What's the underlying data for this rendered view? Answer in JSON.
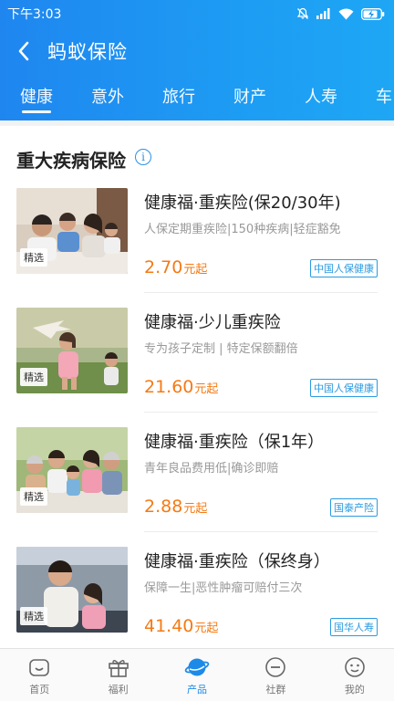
{
  "status_bar": {
    "time": "下午3:03"
  },
  "header": {
    "title": "蚂蚁保险"
  },
  "tabs": [
    "健康",
    "意外",
    "旅行",
    "财产",
    "人寿",
    "车"
  ],
  "section": {
    "title": "重大疾病保险",
    "info_icon": "i"
  },
  "products": [
    {
      "name": "健康福·重疾险(保20/30年)",
      "desc": "人保定期重疾险|150种疾病|轻症豁免",
      "price": "2.70",
      "unit": "元起",
      "tag": "精选",
      "insurer": "中国人保健康"
    },
    {
      "name": "健康福·少儿重疾险",
      "desc": "专为孩子定制 | 特定保额翻倍",
      "price": "21.60",
      "unit": "元起",
      "tag": "精选",
      "insurer": "中国人保健康"
    },
    {
      "name": "健康福·重疾险（保1年）",
      "desc": "青年良品费用低|确诊即赔",
      "price": "2.88",
      "unit": "元起",
      "tag": "精选",
      "insurer": "国泰产险"
    },
    {
      "name": "健康福·重疾险（保终身）",
      "desc": "保障一生|恶性肿瘤可赔付三次",
      "price": "41.40",
      "unit": "元起",
      "tag": "精选",
      "insurer": "国华人寿"
    }
  ],
  "bottom_nav": [
    {
      "label": "首页",
      "icon": "home-icon"
    },
    {
      "label": "福利",
      "icon": "gift-icon"
    },
    {
      "label": "产品",
      "icon": "planet-icon",
      "active": true
    },
    {
      "label": "社群",
      "icon": "chat-icon"
    },
    {
      "label": "我的",
      "icon": "profile-icon"
    }
  ],
  "colors": {
    "header_blue": "#1d94f2",
    "price_orange": "#f57a14",
    "insurer_blue": "#2b9be0",
    "active_nav": "#1d8ae8"
  }
}
